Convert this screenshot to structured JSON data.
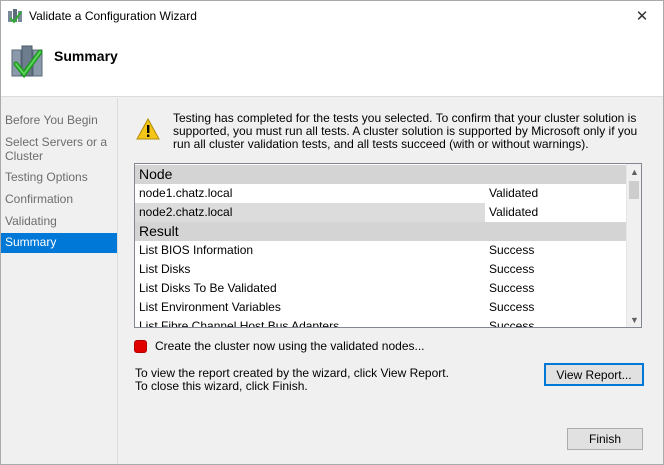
{
  "window": {
    "title": "Validate a Configuration Wizard",
    "close_label": "✕"
  },
  "header": {
    "title": "Summary",
    "icon": "validate-check-icon"
  },
  "sidebar": {
    "items": [
      {
        "label": "Before You Begin",
        "active": false
      },
      {
        "label": "Select Servers or a Cluster",
        "active": false
      },
      {
        "label": "Testing Options",
        "active": false
      },
      {
        "label": "Confirmation",
        "active": false
      },
      {
        "label": "Validating",
        "active": false
      },
      {
        "label": "Summary",
        "active": true
      }
    ]
  },
  "main": {
    "intro": "Testing has completed for the tests you selected. To confirm that your cluster solution is supported, you must run all tests.  A cluster solution is supported by Microsoft only if you run all cluster validation tests, and all tests succeed (with or without warnings).",
    "node_section": "Node",
    "nodes": [
      {
        "name": "node1.chatz.local",
        "status": "Validated"
      },
      {
        "name": "node2.chatz.local",
        "status": "Validated"
      }
    ],
    "result_section": "Result",
    "results": [
      {
        "name": "List BIOS Information",
        "status": "Success"
      },
      {
        "name": "List Disks",
        "status": "Success"
      },
      {
        "name": "List Disks To Be Validated",
        "status": "Success"
      },
      {
        "name": "List Environment Variables",
        "status": "Success"
      },
      {
        "name": "List Fibre Channel Host Bus Adapters",
        "status": "Success"
      }
    ],
    "create_cluster_label": "Create the cluster now using the validated nodes...",
    "info_line1": "To view the report created by the wizard, click View Report.",
    "info_line2": "To close this wizard, click Finish.",
    "view_report_label": "View Report...",
    "finish_label": "Finish"
  },
  "colors": {
    "selection": "#0078d7",
    "section_header": "#d4d4d4",
    "checkbox": "#e00000"
  }
}
